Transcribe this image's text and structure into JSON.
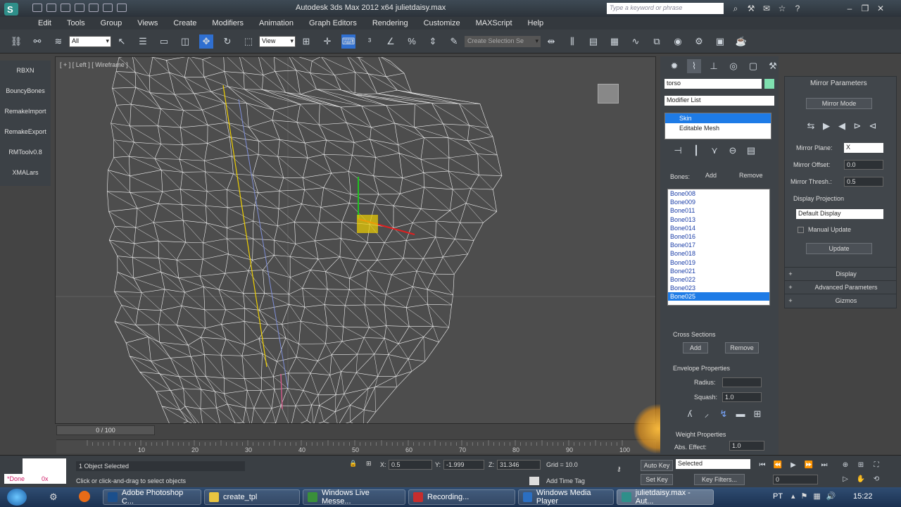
{
  "titlebar": {
    "title": "Autodesk 3ds Max  2012 x64      julietdaisy.max",
    "search_placeholder": "Type a keyword or phrase"
  },
  "menu": [
    "Edit",
    "Tools",
    "Group",
    "Views",
    "Create",
    "Modifiers",
    "Animation",
    "Graph Editors",
    "Rendering",
    "Customize",
    "MAXScript",
    "Help"
  ],
  "toolbar": {
    "selection_filter": "All",
    "ref_coord": "View",
    "named_selection": "Create Selection Se"
  },
  "left_commands": [
    "RBXN",
    "BouncyBones",
    "RemakeImport",
    "RemakeExport",
    "RMToolv0.8",
    "XMALars"
  ],
  "viewport": {
    "label": "[ + ] [ Left ] [ Wireframe ]"
  },
  "timeline": {
    "slider": "0 / 100",
    "ticks": [
      "10",
      "20",
      "30",
      "40",
      "50",
      "60",
      "70",
      "80",
      "90",
      "100"
    ]
  },
  "cmd_panel": {
    "object_name": "torso",
    "modifier_list": "Modifier List",
    "stack": [
      {
        "label": "Skin",
        "selected": true
      },
      {
        "label": "Editable Mesh",
        "selected": false
      }
    ],
    "bones_label": "Bones:",
    "add": "Add",
    "remove": "Remove",
    "bones": [
      "Bone008",
      "Bone009",
      "Bone011",
      "Bone013",
      "Bone014",
      "Bone016",
      "Bone017",
      "Bone018",
      "Bone019",
      "Bone021",
      "Bone022",
      "Bone023",
      "Bone025"
    ],
    "selected_bone": "Bone025",
    "cross_sections": "Cross Sections",
    "cs_add": "Add",
    "cs_remove": "Remove",
    "envelope_props": "Envelope Properties",
    "radius_label": "Radius:",
    "squash_label": "Squash:",
    "squash_value": "1.0",
    "weight_props": "Weight Properties",
    "abs_effect_label": "Abs. Effect:",
    "abs_effect_value": "1.0"
  },
  "mirror": {
    "title": "Mirror Parameters",
    "mode_btn": "Mirror Mode",
    "plane_label": "Mirror Plane:",
    "plane_value": "X",
    "offset_label": "Mirror Offset:",
    "offset_value": "0.0",
    "thresh_label": "Mirror Thresh.:",
    "thresh_value": "0.5",
    "display_projection": "Display Projection",
    "display_value": "Default Display",
    "manual_update": "Manual Update",
    "update_btn": "Update",
    "rollouts": [
      "Display",
      "Advanced Parameters",
      "Gizmos"
    ]
  },
  "status": {
    "left_cell1": "*Done",
    "left_cell2": "0x",
    "selected_text": "1 Object Selected",
    "prompt": "Click or click-and-drag to select objects",
    "x": "0.5",
    "y": "-1.999",
    "z": "31.346",
    "grid": "Grid = 10.0",
    "add_time_tag": "Add Time Tag",
    "auto_key": "Auto Key",
    "set_key": "Set Key",
    "key_mode": "Selected",
    "key_filters": "Key Filters...",
    "frame": "0"
  },
  "taskbar": {
    "tasks": [
      "Adobe Photoshop C...",
      "create_tpl",
      "Windows Live Messe...",
      "Recording...",
      "Windows Media Player",
      "julietdaisy.max - Aut..."
    ],
    "lang": "PT",
    "time": "15:22"
  },
  "colors": {
    "accent_blue": "#1e7be6",
    "gizmo_yellow": "#f0d000",
    "gizmo_red": "#e02020",
    "gizmo_green": "#20c020"
  }
}
